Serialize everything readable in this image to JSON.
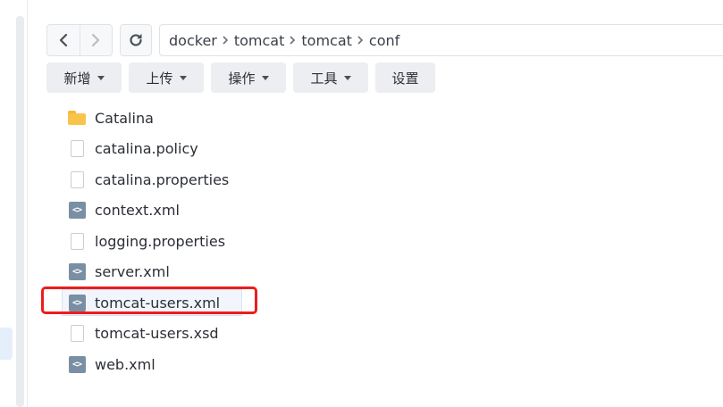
{
  "path": {
    "segments": [
      "docker",
      "tomcat",
      "tomcat",
      "conf"
    ]
  },
  "toolbar": {
    "new_label": "新增",
    "upload_label": "上传",
    "action_label": "操作",
    "tools_label": "工具",
    "settings_label": "设置"
  },
  "files": [
    {
      "name": "Catalina",
      "icon": "folder-icon"
    },
    {
      "name": "catalina.policy",
      "icon": "file-icon"
    },
    {
      "name": "catalina.properties",
      "icon": "file-icon"
    },
    {
      "name": "context.xml",
      "icon": "xml-code-icon"
    },
    {
      "name": "logging.properties",
      "icon": "file-icon"
    },
    {
      "name": "server.xml",
      "icon": "xml-code-icon"
    },
    {
      "name": "tomcat-users.xml",
      "icon": "xml-code-icon",
      "selected": true
    },
    {
      "name": "tomcat-users.xsd",
      "icon": "file-icon"
    },
    {
      "name": "web.xml",
      "icon": "xml-code-icon"
    }
  ],
  "colors": {
    "highlight": "#ee1c1c",
    "folder": "#f8c44c",
    "xml_icon": "#7a8fa3"
  },
  "code_icon_glyph": "<>"
}
